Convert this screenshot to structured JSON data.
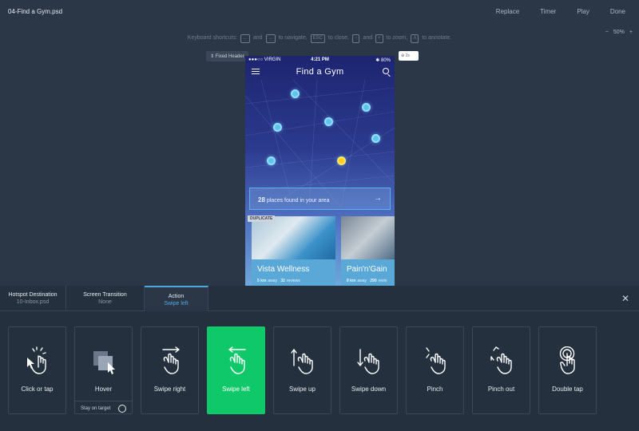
{
  "file_name": "04-Find a Gym.psd",
  "top_actions": [
    "Replace",
    "Timer",
    "Play",
    "Done"
  ],
  "zoom": {
    "minus": "−",
    "level": "50%",
    "plus": "+"
  },
  "shortcuts": {
    "lead": "Keyboard shortcuts:",
    "k_left": "←",
    "and1": "and",
    "k_right": "→",
    "nav": "to navigate,",
    "k_esc": "ESC",
    "close": "to close,",
    "k_minus": "−",
    "and2": "and",
    "k_plus": "+",
    "zoomt": "to zoom,",
    "k_a": "A",
    "annotate": "to annotate."
  },
  "fixed_header": "⇕ Fixed Header",
  "hotspot_tag": "⊕ 2s",
  "phone": {
    "carrier": "●●●○○ VIRGIN",
    "time": "4:21 PM",
    "battery": "✱ 80%",
    "title": "Find a Gym",
    "places_count": "28",
    "places_text": "places found in your area",
    "places_arrow": "→",
    "duplicate": "DUPLICATE",
    "cards": [
      {
        "name": "Vista Wellness",
        "dist": "5 km",
        "dist_label": "away",
        "reviews": "32",
        "reviews_label": "reviews"
      },
      {
        "name": "Pain'n'Gain",
        "dist": "8 km",
        "dist_label": "away",
        "reviews": "290",
        "reviews_label": "revie"
      }
    ]
  },
  "tabs": [
    {
      "title": "Hotspot Destination",
      "sub": "10-Inbox.psd"
    },
    {
      "title": "Screen Transition",
      "sub": "None"
    },
    {
      "title": "Action",
      "sub": "Swipe left"
    }
  ],
  "close": "✕",
  "gestures": [
    {
      "label": "Click or tap"
    },
    {
      "label": "Hover",
      "extra": "Stay on target"
    },
    {
      "label": "Swipe right"
    },
    {
      "label": "Swipe left"
    },
    {
      "label": "Swipe up"
    },
    {
      "label": "Swipe down"
    },
    {
      "label": "Pinch"
    },
    {
      "label": "Pinch out"
    },
    {
      "label": "Double tap"
    }
  ],
  "colors": {
    "accent_blue": "#4aa9e0",
    "selected_green": "#0fc86a",
    "bg": "#2b3747"
  }
}
